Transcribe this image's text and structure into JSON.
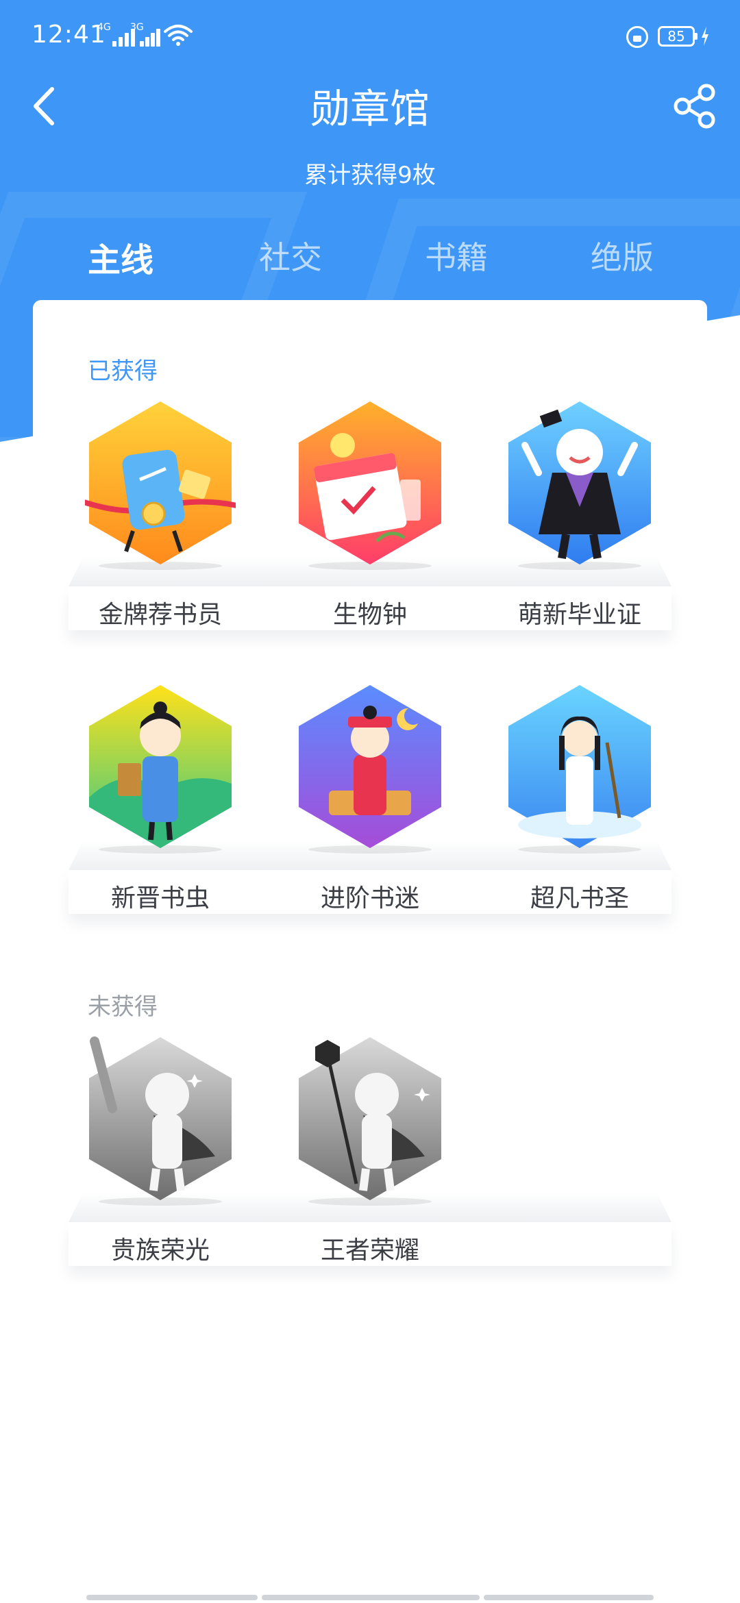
{
  "status_bar": {
    "time": "12:41",
    "signal_1_label": "4G",
    "signal_2_label": "3G",
    "battery": "85"
  },
  "header": {
    "title": "勋章馆",
    "subtitle": "累计获得9枚"
  },
  "tabs": [
    {
      "label": "主线",
      "active": true
    },
    {
      "label": "社交",
      "active": false
    },
    {
      "label": "书籍",
      "active": false
    },
    {
      "label": "绝版",
      "active": false
    }
  ],
  "sections": {
    "earned": {
      "title": "已获得",
      "badges": [
        {
          "label": "金牌荐书员",
          "icon": "gold-recommender-badge-icon"
        },
        {
          "label": "生物钟",
          "icon": "biological-clock-badge-icon"
        },
        {
          "label": "萌新毕业证",
          "icon": "newbie-graduate-badge-icon"
        },
        {
          "label": "新晋书虫",
          "icon": "new-bookworm-badge-icon"
        },
        {
          "label": "进阶书迷",
          "icon": "advanced-book-fan-badge-icon"
        },
        {
          "label": "超凡书圣",
          "icon": "book-sage-badge-icon"
        }
      ]
    },
    "unearned": {
      "title": "未获得",
      "badges": [
        {
          "label": "贵族荣光",
          "icon": "noble-glory-badge-icon"
        },
        {
          "label": "王者荣耀",
          "icon": "king-glory-badge-icon"
        }
      ]
    }
  },
  "colors": {
    "accent": "#3e97f6",
    "muted": "#9aa0a6"
  }
}
